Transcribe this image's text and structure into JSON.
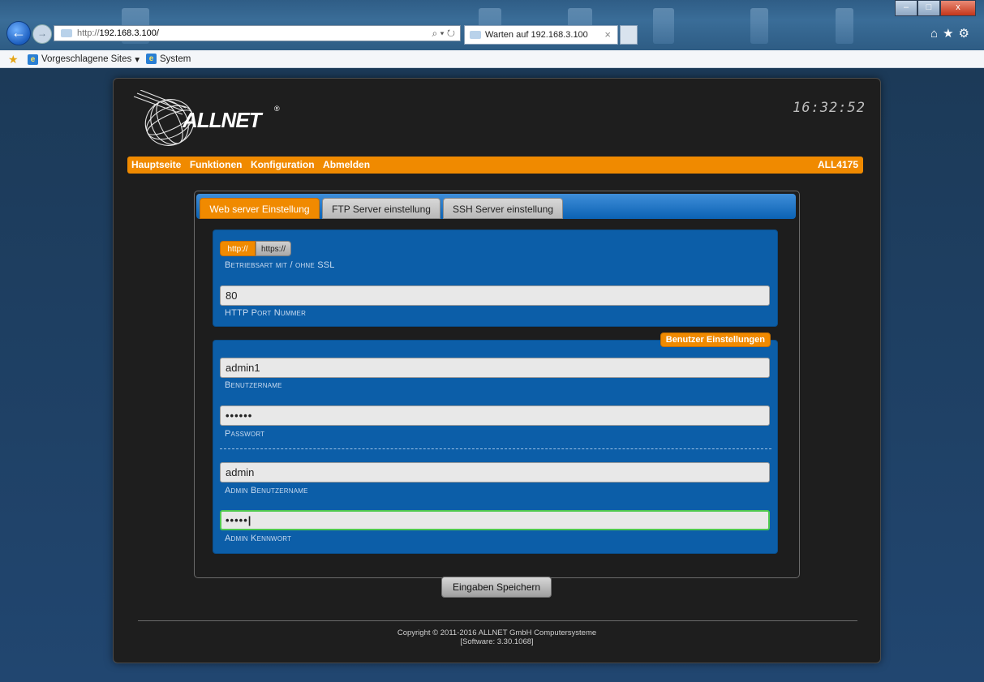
{
  "browser": {
    "address_prefix": "http://",
    "address_host": "192.168.3.100/",
    "address_controls": "⌕ ▾ ↻",
    "tab_title": "Warten auf 192.168.3.100",
    "tab_close": "×",
    "win_min": "–",
    "win_max": "□",
    "win_close": "x",
    "toolbar_icons": "⌂★⚙",
    "back_glyph": "←",
    "forward_glyph": "→",
    "favorites": [
      {
        "label": "Vorgeschlagene Sites",
        "dropdown": "▾"
      },
      {
        "label": "System"
      }
    ]
  },
  "header": {
    "logo_text": "ALLNET",
    "logo_reg": "®",
    "clock": "16:32:52"
  },
  "menu": {
    "items": [
      "Hauptseite",
      "Funktionen",
      "Konfiguration",
      "Abmelden"
    ],
    "device": "ALL4175"
  },
  "tabs": [
    {
      "label": "Web server Einstellung",
      "active": true
    },
    {
      "label": "FTP Server einstellung",
      "active": false
    },
    {
      "label": "SSH Server einstellung",
      "active": false
    }
  ],
  "server_section": {
    "toggle": {
      "http": "http://",
      "https": "https://",
      "selected": "http://"
    },
    "mode_label": "Betriebsart mit / ohne SSL",
    "port_value": "80",
    "port_label": "HTTP Port Nummer"
  },
  "user_section": {
    "badge": "Benutzer Einstellungen",
    "username_value": "admin1",
    "username_label": "Benutzername",
    "password_value": "••••••",
    "password_label": "Passwort",
    "admin_username_value": "admin",
    "admin_username_label": "Admin Benutzername",
    "admin_password_value": "•••••|",
    "admin_password_label": "Admin Kennwort"
  },
  "save_button": "Eingaben Speichern",
  "footer": {
    "copyright": "Copyright © 2011-2016 ALLNET GmbH Computersysteme",
    "software": "[Software: 3.30.1068]"
  },
  "colors": {
    "accent": "#f08a00",
    "section_blue": "#0c5ea8",
    "panel": "#1e1e1e"
  }
}
